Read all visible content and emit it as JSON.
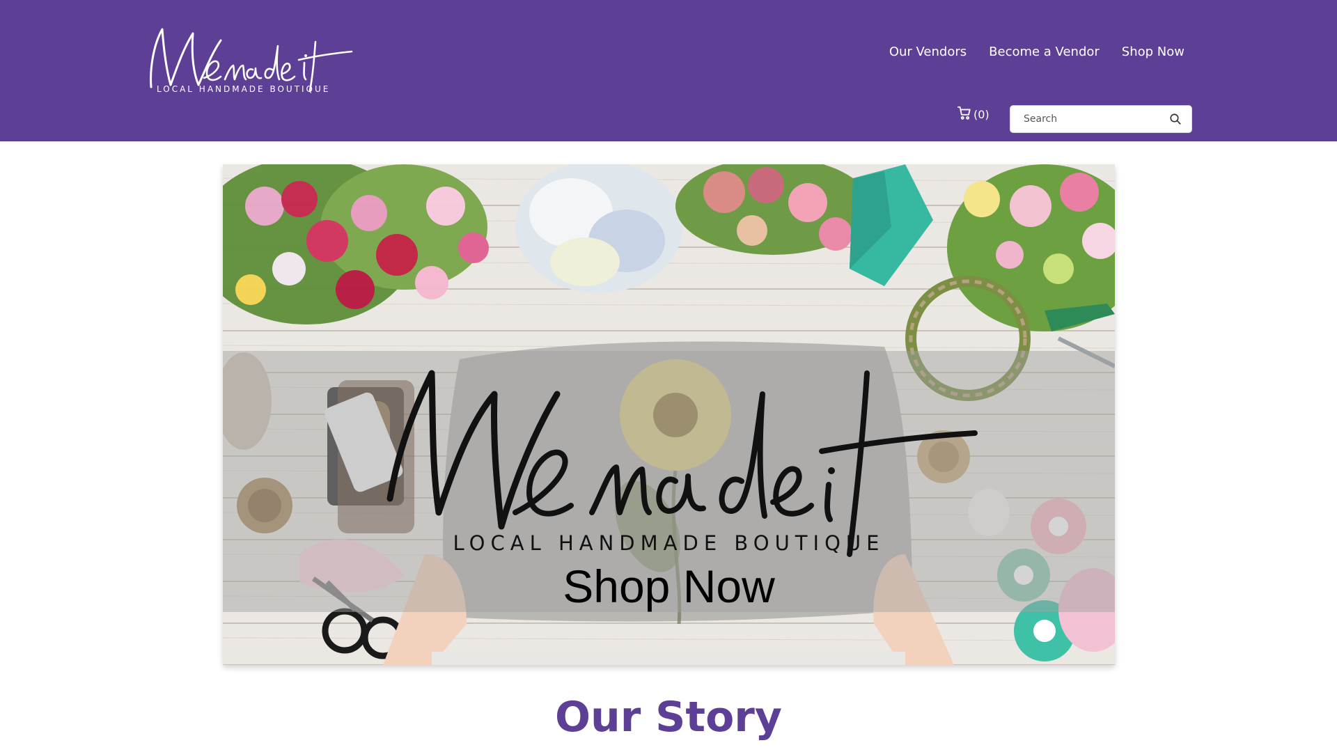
{
  "brand": {
    "logo_script": "We made it",
    "logo_subtitle": "LOCAL HANDMADE BOUTIQUE",
    "primary_color": "#5e3f96"
  },
  "nav": {
    "items": [
      {
        "label": "Our Vendors"
      },
      {
        "label": "Become a Vendor"
      },
      {
        "label": "Shop Now"
      }
    ]
  },
  "cart": {
    "icon": "cart-icon",
    "count_label": "(0)"
  },
  "search": {
    "placeholder": "Search",
    "value": "",
    "icon": "search-icon"
  },
  "hero": {
    "script_text": "We made it",
    "subtitle": "LOCAL HANDMADE BOUTIQUE",
    "cta": "Shop Now"
  },
  "story": {
    "title": "Our Story"
  }
}
